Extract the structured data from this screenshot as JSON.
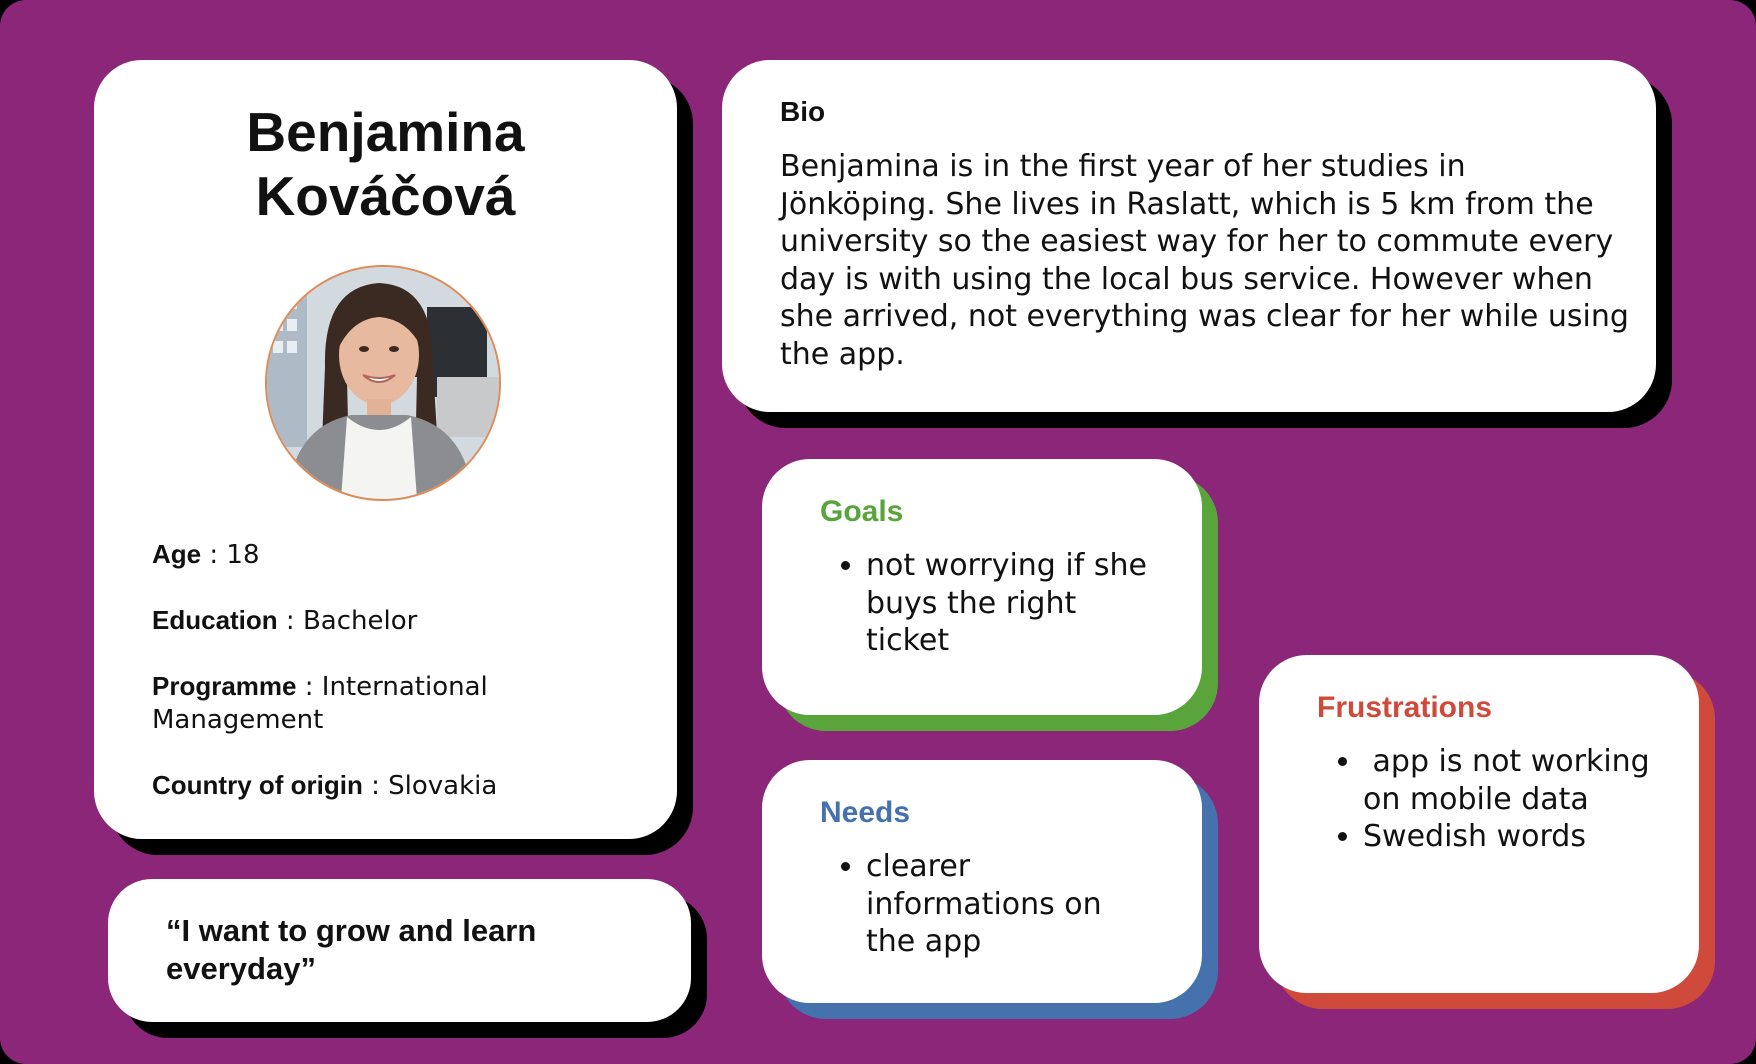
{
  "profile": {
    "name_line1": "Benjamina",
    "name_line2": "Kováčová",
    "facts": [
      {
        "label": "Age",
        "value": " : 18"
      },
      {
        "label": "Education",
        "value": " : Bachelor"
      },
      {
        "label": "Programme",
        "value": " : International Management"
      },
      {
        "label": "Country of origin",
        "value": " : Slovakia"
      }
    ]
  },
  "quote": {
    "line1": "“I want to grow and learn",
    "line2": "everyday”"
  },
  "bio": {
    "title": "Bio",
    "text": "Benjamina is in the first year of her studies in Jönköping. She lives in Raslatt, which is 5 km from the university so the easiest way for her to commute every day is with using the local bus service. However when she arrived, not everything was clear for her while using the app."
  },
  "goals": {
    "title": "Goals",
    "items": [
      "not worrying if she buys the right ticket"
    ]
  },
  "needs": {
    "title": "Needs",
    "items": [
      "clearer informations on the app"
    ]
  },
  "frustrations": {
    "title": "Frustrations",
    "items": [
      " app is not working on mobile data",
      "Swedish words"
    ]
  },
  "colors": {
    "background": "#8b2679",
    "goals": "#5aa53b",
    "needs": "#4572ad",
    "frustrations": "#d04a3c"
  }
}
